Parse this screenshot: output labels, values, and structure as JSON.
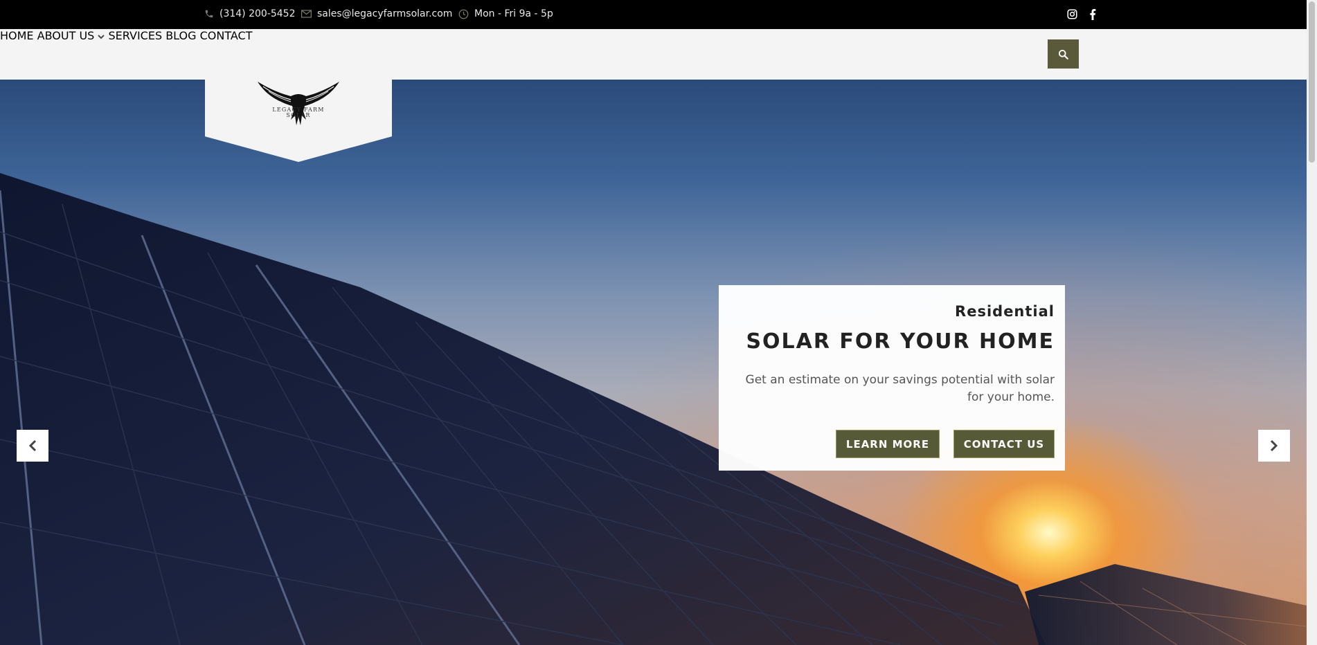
{
  "topbar": {
    "phone": "(314) 200-5452",
    "email": "sales@legacyfarmsolar.com",
    "hours": "Mon - Fri 9a - 5p",
    "icons": {
      "phone": "phone-icon",
      "email": "envelope-icon",
      "hours": "clock-icon"
    },
    "social": [
      "instagram-icon",
      "facebook-icon"
    ]
  },
  "logo": {
    "line1": "LEGACY FARM",
    "line2": "SOLAR"
  },
  "nav": {
    "items": [
      {
        "label": "HOME"
      },
      {
        "label": "ABOUT US",
        "dropdown": true
      },
      {
        "label": "SERVICES"
      },
      {
        "label": "BLOG"
      },
      {
        "label": "CONTACT"
      }
    ],
    "search_icon": "search-icon"
  },
  "hero": {
    "eyebrow": "Residential",
    "title": "SOLAR FOR YOUR HOME",
    "description": "Get an estimate on your savings potential with solar for your home.",
    "buttons": {
      "learn_more": "LEARN MORE",
      "contact_us": "CONTACT US"
    },
    "prev_icon": "chevron-left-icon",
    "next_icon": "chevron-right-icon"
  },
  "colors": {
    "accent": "#575a37",
    "topbar_bg": "#000000",
    "header_bg": "#f4f4f4"
  }
}
